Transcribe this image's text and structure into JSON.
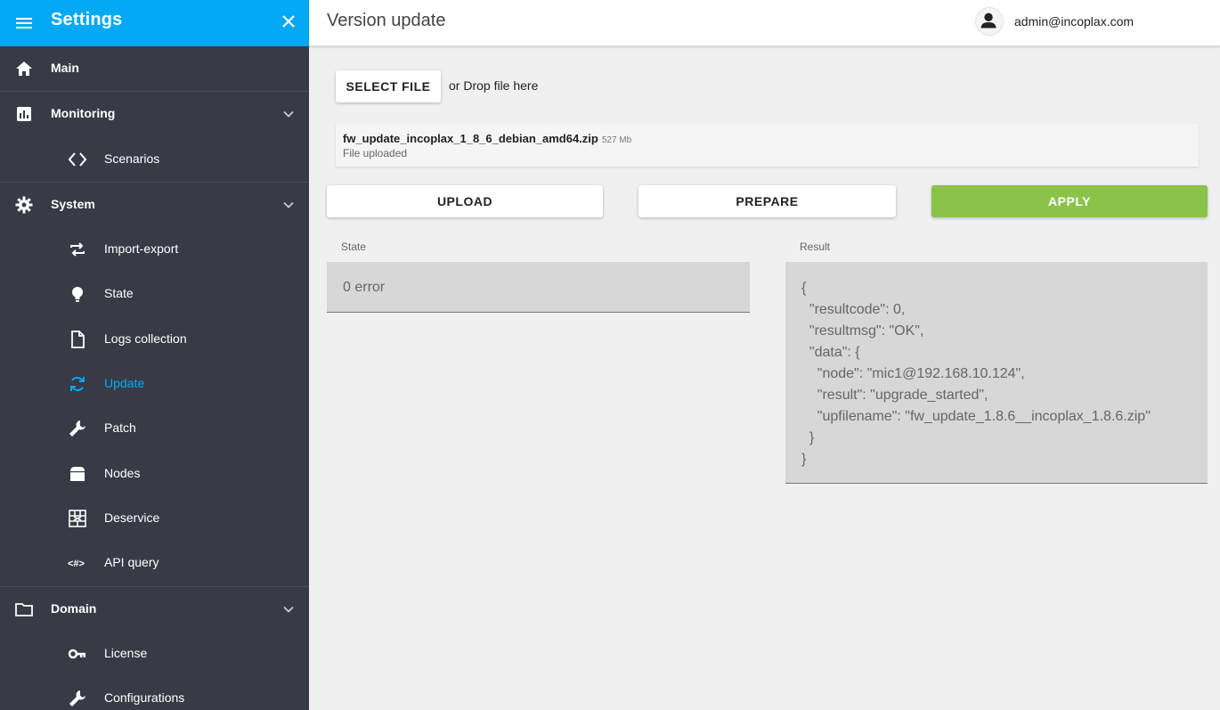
{
  "sidebar": {
    "title": "Settings",
    "items": [
      {
        "label": "Main",
        "icon": "home-icon",
        "type": "section"
      },
      {
        "label": "Monitoring",
        "icon": "chart-icon",
        "type": "section",
        "expandable": true
      },
      {
        "label": "Scenarios",
        "icon": "code-icon",
        "type": "sub"
      },
      {
        "label": "System",
        "icon": "gear-icon",
        "type": "section",
        "expandable": true
      },
      {
        "label": "Import-export",
        "icon": "swap-icon",
        "type": "sub"
      },
      {
        "label": "State",
        "icon": "bulb-icon",
        "type": "sub"
      },
      {
        "label": "Logs collection",
        "icon": "file-icon",
        "type": "sub"
      },
      {
        "label": "Update",
        "icon": "sync-icon",
        "type": "sub",
        "active": true
      },
      {
        "label": "Patch",
        "icon": "wrench-icon",
        "type": "sub"
      },
      {
        "label": "Nodes",
        "icon": "node-icon",
        "type": "sub"
      },
      {
        "label": "Deservice",
        "icon": "wall-icon",
        "type": "sub"
      },
      {
        "label": "API query",
        "icon": "api-icon",
        "type": "sub"
      },
      {
        "label": "Domain",
        "icon": "folder-icon",
        "type": "section",
        "expandable": true
      },
      {
        "label": "License",
        "icon": "key-icon",
        "type": "sub"
      },
      {
        "label": "Configurations",
        "icon": "wrench-icon",
        "type": "sub"
      }
    ]
  },
  "header": {
    "page_title": "Version update",
    "user_email": "admin@incoplax.com"
  },
  "upload": {
    "select_label": "SELECT FILE",
    "drop_text": "or Drop file here",
    "file_name": "fw_update_incoplax_1_8_6_debian_amd64.zip",
    "file_size": "527 Mb",
    "file_status": "File uploaded"
  },
  "actions": {
    "upload_label": "UPLOAD",
    "prepare_label": "PREPARE",
    "apply_label": "APPLY"
  },
  "state": {
    "label": "State",
    "value": "0 error"
  },
  "result": {
    "label": "Result",
    "value": "{\n  \"resultcode\": 0,\n  \"resultmsg\": \"OK\",\n  \"data\": {\n    \"node\": \"mic1@192.168.10.124\",\n    \"result\": \"upgrade_started\",\n    \"upfilename\": \"fw_update_1.8.6__incoplax_1.8.6.zip\"\n  }\n}"
  },
  "colors": {
    "accent": "#03a9f4",
    "sidebar_bg": "#383a46",
    "apply_green": "#8bc34a"
  }
}
